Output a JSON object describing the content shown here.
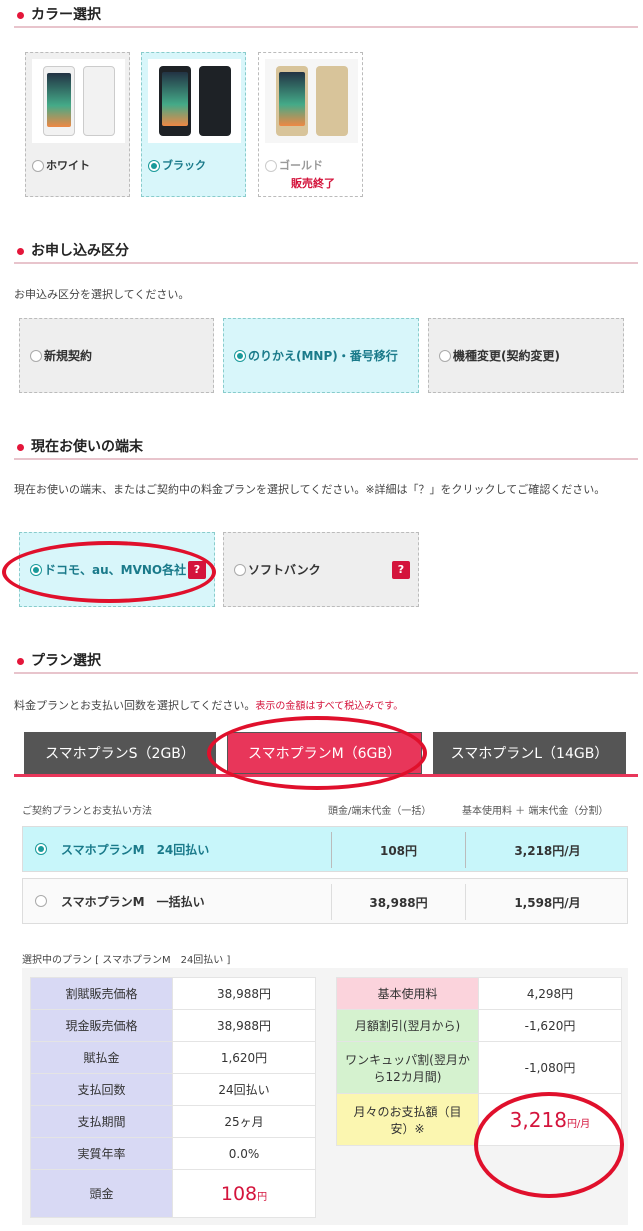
{
  "color_section": {
    "title": "カラー選択",
    "options": [
      {
        "label": "ホワイト",
        "selected": false,
        "phone_color": "#f2f2f2"
      },
      {
        "label": "ブラック",
        "selected": true,
        "phone_color": "#1e2226"
      },
      {
        "label": "ゴールド",
        "selected": false,
        "disabled": true,
        "note": "販売終了",
        "phone_color": "#d8c49a"
      }
    ]
  },
  "apply_section": {
    "title": "お申し込み区分",
    "description": "お申込み区分を選択してください。",
    "options": [
      {
        "label": "新規契約",
        "selected": false
      },
      {
        "label": "のりかえ(MNP)・番号移行",
        "selected": true
      },
      {
        "label": "機種変更(契約変更)",
        "selected": false
      }
    ]
  },
  "device_section": {
    "title": "現在お使いの端末",
    "description": "現在お使いの端末、またはご契約中の料金プランを選択してください。※詳細は「？」をクリックしてご確認ください。",
    "options": [
      {
        "label": "ドコモ、au、MVNO各社",
        "selected": true,
        "help": "?"
      },
      {
        "label": "ソフトバンク",
        "selected": false,
        "help": "?"
      }
    ]
  },
  "plan_section": {
    "title": "プラン選択",
    "description": "料金プランとお支払い回数を選択してください。",
    "tax_note": "表示の金額はすべて税込みです。",
    "tabs": [
      {
        "label": "スマホプランS（2GB）",
        "selected": false
      },
      {
        "label": "スマホプランM（6GB）",
        "selected": true
      },
      {
        "label": "スマホプランL（14GB）",
        "selected": false
      }
    ],
    "headers": {
      "method": "ご契約プランとお支払い方法",
      "upfront": "頭金/端末代金（一括）",
      "monthly": "基本使用料 ＋ 端末代金（分割）"
    },
    "rows": [
      {
        "name": "スマホプランM　24回払い",
        "upfront": "108円",
        "monthly": "3,218円/月",
        "selected": true
      },
      {
        "name": "スマホプランM　一括払い",
        "upfront": "38,988円",
        "monthly": "1,598円/月",
        "selected": false
      }
    ]
  },
  "selected_plan": {
    "caption": "選択中のプラン [ スマホプランM　24回払い ]",
    "left": [
      {
        "label": "割賦販売価格",
        "value": "38,988円"
      },
      {
        "label": "現金販売価格",
        "value": "38,988円"
      },
      {
        "label": "賦払金",
        "value": "1,620円"
      },
      {
        "label": "支払回数",
        "value": "24回払い"
      },
      {
        "label": "支払期間",
        "value": "25ヶ月"
      },
      {
        "label": "実質年率",
        "value": "0.0%"
      },
      {
        "label": "頭金",
        "value_num": "108",
        "value_unit": "円"
      }
    ],
    "right": [
      {
        "label": "基本使用料",
        "value": "4,298円",
        "color": "#fbd3dc"
      },
      {
        "label": "月額割引(翌月から)",
        "value": "-1,620円",
        "color": "#d5f2cf"
      },
      {
        "label": "ワンキュッパ割(翌月から12カ月間)",
        "value": "-1,080円",
        "color": "#d5f2cf"
      },
      {
        "label": "月々のお支払額（目安）※",
        "value_num": "3,218",
        "value_unit": "円/月",
        "color": "#fbf6b0"
      }
    ]
  },
  "colors": {
    "accent": "#e4163a",
    "selected_bg": "#d8f6fa",
    "teal": "#1a9a9a",
    "annotation": "#e0102c"
  }
}
